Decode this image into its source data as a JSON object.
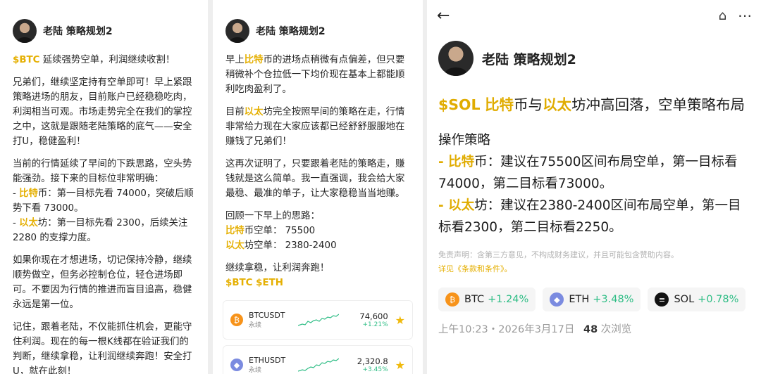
{
  "panel1": {
    "author": "老陆 策略规划2",
    "para1": {
      "tag": "$BTC",
      "text": " 延续强势空单，利润继续收割！"
    },
    "para2": "兄弟们，继续坚定持有空单即可！早上紧跟策略进场的朋友，目前账户已经稳稳吃肉，利润相当可观。市场走势完全在我们的掌控之中，这就是跟随老陆策略的底气——安全打U，稳健盈利！",
    "para3": "当前的行情延续了早间的下跌思路，空头势能强劲。接下来的目标位非常明确：",
    "line_btc": {
      "prefix": "- ",
      "hl": "比特",
      "text": "币：第一目标先看 74000，突破后顺势下看 73000。"
    },
    "line_eth": {
      "prefix": "- ",
      "hl": "以太",
      "text": "坊：第一目标先看 2300，后续关注 2280 的支撑力度。"
    },
    "para4": "如果你现在才想进场，切记保持冷静，继续顺势做空，但务必控制仓位，轻仓进场即可。不要因为行情的推进而盲目追高，稳健永远是第一位。",
    "para5": "记住，跟着老陆，不仅能抓住机会，更能守住利润。现在的每一根K线都在验证我们的判断，继续拿稳，让利润继续奔跑！安全打U，就在此刻！"
  },
  "panel2": {
    "author": "老陆 策略规划2",
    "para1": {
      "pre": "早上",
      "hl": "比特",
      "text": "币的进场点稍微有点偏差，但只要稍微补个仓拉低一下均价现在基本上都能顺利吃肉盈利了。"
    },
    "para2": {
      "pre": "目前",
      "hl": "以太",
      "text": "坊完全按照早间的策略在走，行情非常给力现在大家应该都已经舒舒服服地在赚钱了兄弟们！"
    },
    "para3": "这再次证明了，只要跟着老陆的策略走，赚钱就是这么简单。我一直强调，我会给大家最稳、最准的单子，让大家稳稳当当地赚。",
    "review_title": "回顾一下早上的思路：",
    "review_btc": {
      "hl": "比特",
      "text": "币空单：  75500"
    },
    "review_eth": {
      "hl": "以太",
      "text": "坊空单：  2380-2400"
    },
    "para5": "继续拿稳，让利润奔跑！",
    "tags": "$BTC $ETH",
    "tickers": [
      {
        "symbol": "BTCUSDT",
        "sub": "永续",
        "price": "74,600",
        "change": "+1.21%",
        "icon": "bitcoin-icon"
      },
      {
        "symbol": "ETHUSDT",
        "sub": "永续",
        "price": "2,320.8",
        "change": "+3.45%",
        "icon": "ethereum-icon"
      }
    ]
  },
  "panel3": {
    "author": "老陆 策略规划2",
    "title": {
      "tag": "$SOL",
      "hl1": "比特",
      "mid": "币与",
      "hl2": "以太",
      "rest": "坊冲高回落，空单策略布局"
    },
    "heading": "操作策略",
    "line_btc": {
      "prefix": "- ",
      "hl": "比特",
      "text": "币：建议在75500区间布局空单，第一目标看74000，第二目标看73000。"
    },
    "line_eth": {
      "prefix": "- ",
      "hl": "以太",
      "text": "坊：建议在2380-2400区间布局空单，第一目标看2300，第二目标看2250。"
    },
    "disclaimer": "免责声明：含第三方意见，不构成财务建议，并且可能包含赞助内容。",
    "disclaimer_link": "详见《条款和条件》。",
    "chips": [
      {
        "name": "BTC",
        "change": "+1.24%",
        "icon": "bitcoin-icon"
      },
      {
        "name": "ETH",
        "change": "+3.48%",
        "icon": "ethereum-icon"
      },
      {
        "name": "SOL",
        "change": "+0.78%",
        "icon": "solana-icon"
      }
    ],
    "time": "上午10:23・2026年3月17日",
    "views": "48",
    "views_label": " 次浏览"
  },
  "colors": {
    "accent": "#e5b003",
    "up": "#2ebd85",
    "btc": "#f7931a",
    "eth": "#7b8be0"
  }
}
